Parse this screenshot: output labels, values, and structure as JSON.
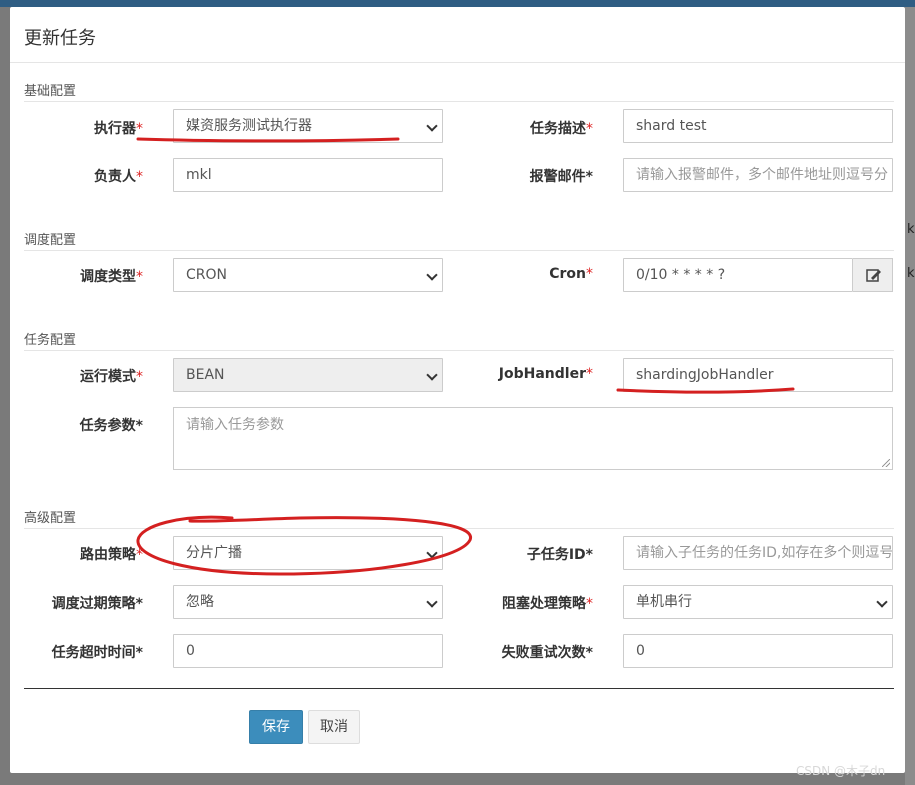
{
  "modal": {
    "title": "更新任务",
    "sections": {
      "basic": "基础配置",
      "schedule": "调度配置",
      "task": "任务配置",
      "advanced": "高级配置"
    }
  },
  "fields": {
    "executor": {
      "label": "执行器",
      "value": "媒资服务测试执行器"
    },
    "job_desc": {
      "label": "任务描述",
      "value": "shard test"
    },
    "author": {
      "label": "负责人",
      "value": "mkl"
    },
    "alarm_email": {
      "label": "报警邮件",
      "placeholder": "请输入报警邮件，多个邮件地址则逗号分"
    },
    "schedule_type": {
      "label": "调度类型",
      "value": "CRON"
    },
    "cron": {
      "label": "Cron",
      "value": "0/10 * * * * ?"
    },
    "run_mode": {
      "label": "运行模式",
      "value": "BEAN"
    },
    "job_handler": {
      "label": "JobHandler",
      "value": "shardingJobHandler"
    },
    "job_param": {
      "label": "任务参数",
      "placeholder": "请输入任务参数"
    },
    "route_strategy": {
      "label": "路由策略",
      "value": "分片广播"
    },
    "child_job_id": {
      "label": "子任务ID",
      "placeholder": "请输入子任务的任务ID,如存在多个则逗号"
    },
    "misfire_strategy": {
      "label": "调度过期策略",
      "value": "忽略"
    },
    "block_strategy": {
      "label": "阻塞处理策略",
      "value": "单机串行"
    },
    "timeout": {
      "label": "任务超时时间",
      "value": "0"
    },
    "fail_retry": {
      "label": "失败重试次数",
      "value": "0"
    }
  },
  "buttons": {
    "save": "保存",
    "cancel": "取消"
  },
  "icons": {
    "cron_edit": "edit-icon"
  },
  "colors": {
    "primary": "#3c8dbc",
    "required": "#dd2222",
    "annotation": "#d42020"
  },
  "watermark": "CSDN @木子dn",
  "background": {
    "fragment_1": "k",
    "fragment_2": "k"
  }
}
